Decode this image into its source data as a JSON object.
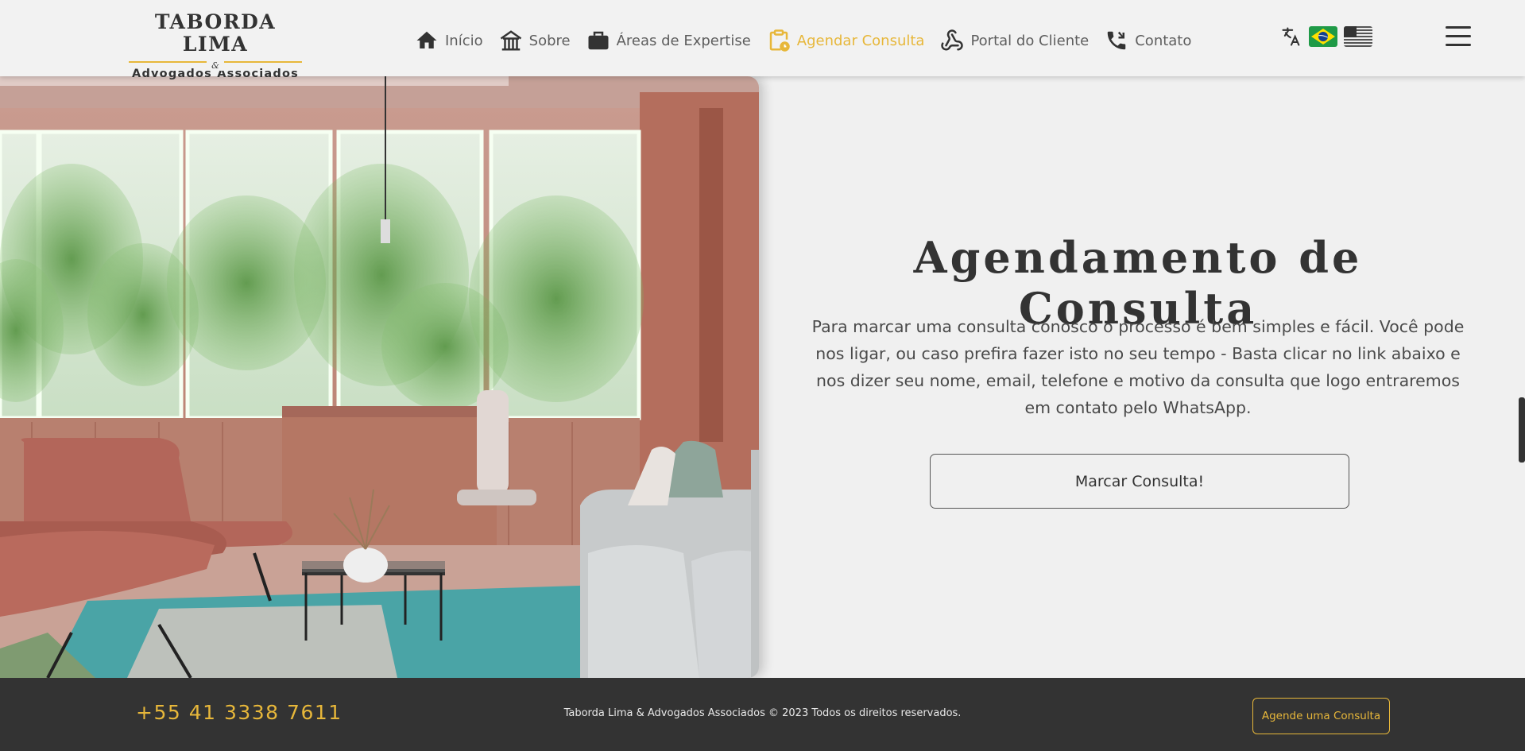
{
  "brand": {
    "title": "TABORDA LIMA",
    "ampersand": "&",
    "subtitle": "Advogados Associados"
  },
  "nav": {
    "items": [
      {
        "label": "Início",
        "icon": "home-icon"
      },
      {
        "label": "Sobre",
        "icon": "building-icon"
      },
      {
        "label": "Áreas de Expertise",
        "icon": "briefcase-icon"
      },
      {
        "label": "Agendar Consulta",
        "icon": "clipboard-clock-icon",
        "active": true
      },
      {
        "label": "Portal do Cliente",
        "icon": "webhook-icon"
      },
      {
        "label": "Contato",
        "icon": "phone-icon"
      }
    ]
  },
  "language": {
    "icon": "translate-icon",
    "flags": [
      "brazil-flag-icon",
      "usa-flag-icon"
    ]
  },
  "hero": {
    "image": "office-lounge-photo"
  },
  "main": {
    "heading": "Agendamento de Consulta",
    "description": "Para marcar uma consulta conosco o processo é bem simples e fácil. Você pode nos ligar, ou caso prefira fazer isto no seu tempo - Basta clicar no link abaixo e nos dizer seu nome, email, telefone e motivo da consulta que logo entraremos em contato pelo WhatsApp.",
    "button_label": "Marcar Consulta!"
  },
  "footer": {
    "phone": "+55 41 3338 7611",
    "copyright": "Taborda Lima & Advogados Associados © 2023 Todos os direitos reservados.",
    "button_label": "Agende uma Consulta"
  },
  "colors": {
    "accent": "#e7b73a",
    "text": "#333333",
    "background": "#f0f0f0",
    "footer": "#333333"
  }
}
